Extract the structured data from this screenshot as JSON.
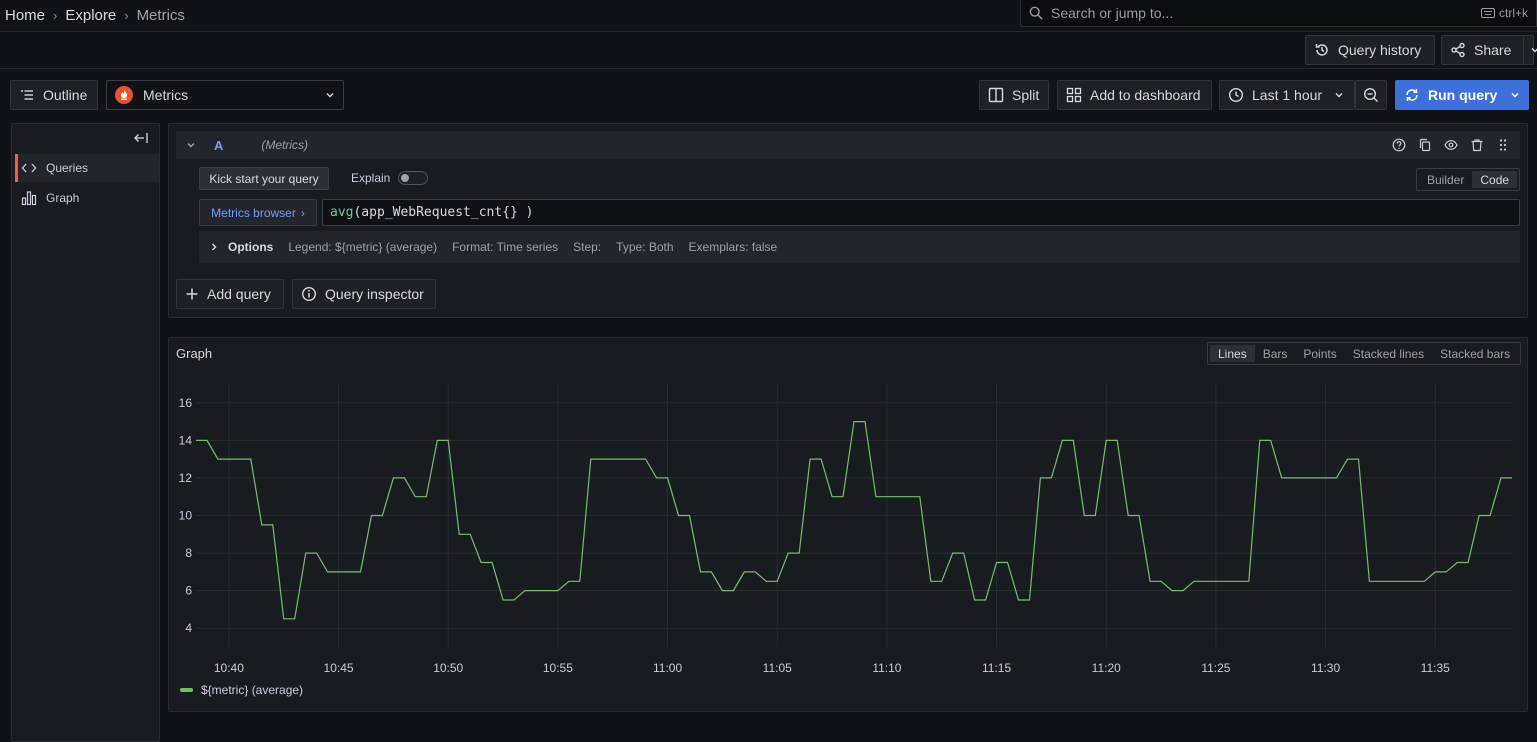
{
  "breadcrumb": {
    "home": "Home",
    "explore": "Explore",
    "current": "Metrics"
  },
  "search": {
    "placeholder": "Search or jump to...",
    "shortcut": "ctrl+k"
  },
  "topbar2": {
    "query_history": "Query history",
    "share": "Share"
  },
  "toolbar": {
    "outline": "Outline",
    "datasource": "Metrics",
    "split": "Split",
    "add_to_dashboard": "Add to dashboard",
    "time_range": "Last 1 hour",
    "run_query": "Run query"
  },
  "sidebar": {
    "items": [
      {
        "label": "Queries",
        "active": true
      },
      {
        "label": "Graph",
        "active": false
      }
    ]
  },
  "query": {
    "ref_id": "A",
    "datasource_name": "(Metrics)",
    "kick_start": "Kick start your query",
    "explain": "Explain",
    "mode_builder": "Builder",
    "mode_code": "Code",
    "metrics_browser": "Metrics browser",
    "expression_fn": "avg",
    "expression_rest": "(app_WebRequest_cnt{} )",
    "options_label": "Options",
    "opt_legend": "Legend: ${metric} (average)",
    "opt_format": "Format: Time series",
    "opt_step": "Step:",
    "opt_type": "Type: Both",
    "opt_exemplars": "Exemplars: false",
    "add_query": "Add query",
    "query_inspector": "Query inspector"
  },
  "graph": {
    "title": "Graph",
    "view_options": [
      "Lines",
      "Bars",
      "Points",
      "Stacked lines",
      "Stacked bars"
    ],
    "selected_view": "Lines"
  },
  "colors": {
    "accent": "#3d71d9",
    "series": "#73bf69",
    "active_marker": "#f55f3e"
  },
  "chart_data": {
    "type": "line",
    "title": "",
    "xlabel": "",
    "ylabel": "",
    "ylim": [
      3,
      17
    ],
    "y_ticks": [
      4,
      6,
      8,
      10,
      12,
      14,
      16
    ],
    "x_ticks": [
      "10:40",
      "10:45",
      "10:50",
      "10:55",
      "11:00",
      "11:05",
      "11:10",
      "11:15",
      "11:20",
      "11:25",
      "11:30",
      "11:35"
    ],
    "x_range": [
      "10:38:30",
      "11:38:30"
    ],
    "grid": true,
    "legend": "bottom-left",
    "series": [
      {
        "name": "${metric} (average)",
        "x": [
          "10:38:30",
          "10:39:00",
          "10:39:30",
          "10:40:00",
          "10:40:30",
          "10:41:00",
          "10:41:30",
          "10:42:00",
          "10:42:30",
          "10:43:00",
          "10:43:30",
          "10:44:00",
          "10:44:30",
          "10:45:00",
          "10:45:30",
          "10:46:00",
          "10:46:30",
          "10:47:00",
          "10:47:30",
          "10:48:00",
          "10:48:30",
          "10:49:00",
          "10:49:30",
          "10:50:00",
          "10:50:30",
          "10:51:00",
          "10:51:30",
          "10:52:00",
          "10:52:30",
          "10:53:00",
          "10:53:30",
          "10:54:00",
          "10:54:30",
          "10:55:00",
          "10:55:30",
          "10:56:00",
          "10:56:30",
          "10:57:00",
          "10:57:30",
          "10:58:00",
          "10:58:30",
          "10:59:00",
          "10:59:30",
          "11:00:00",
          "11:00:30",
          "11:01:00",
          "11:01:30",
          "11:02:00",
          "11:02:30",
          "11:03:00",
          "11:03:30",
          "11:04:00",
          "11:04:30",
          "11:05:00",
          "11:05:30",
          "11:06:00",
          "11:06:30",
          "11:07:00",
          "11:07:30",
          "11:08:00",
          "11:08:30",
          "11:09:00",
          "11:09:30",
          "11:10:00",
          "11:10:30",
          "11:11:00",
          "11:11:30",
          "11:12:00",
          "11:12:30",
          "11:13:00",
          "11:13:30",
          "11:14:00",
          "11:14:30",
          "11:15:00",
          "11:15:30",
          "11:16:00",
          "11:16:30",
          "11:17:00",
          "11:17:30",
          "11:18:00",
          "11:18:30",
          "11:19:00",
          "11:19:30",
          "11:20:00",
          "11:20:30",
          "11:21:00",
          "11:21:30",
          "11:22:00",
          "11:22:30",
          "11:23:00",
          "11:23:30",
          "11:24:00",
          "11:24:30",
          "11:25:00",
          "11:25:30",
          "11:26:00",
          "11:26:30",
          "11:27:00",
          "11:27:30",
          "11:28:00",
          "11:28:30",
          "11:29:00",
          "11:29:30",
          "11:30:00",
          "11:30:30",
          "11:31:00",
          "11:31:30",
          "11:32:00",
          "11:32:30",
          "11:33:00",
          "11:33:30",
          "11:34:00",
          "11:34:30",
          "11:35:00",
          "11:35:30",
          "11:36:00",
          "11:36:30",
          "11:37:00",
          "11:37:30",
          "11:38:00",
          "11:38:30"
        ],
        "values": [
          14,
          14,
          13,
          13,
          13,
          13,
          9.5,
          9.5,
          4.5,
          4.5,
          8,
          8,
          7,
          7,
          7,
          7,
          10,
          10,
          12,
          12,
          11,
          11,
          14,
          14,
          9,
          9,
          7.5,
          7.5,
          5.5,
          5.5,
          6,
          6,
          6,
          6,
          6.5,
          6.5,
          13,
          13,
          13,
          13,
          13,
          13,
          12,
          12,
          10,
          10,
          7,
          7,
          6,
          6,
          7,
          7,
          6.5,
          6.5,
          8,
          8,
          13,
          13,
          11,
          11,
          15,
          15,
          11,
          11,
          11,
          11,
          11,
          6.5,
          6.5,
          8,
          8,
          5.5,
          5.5,
          7.5,
          7.5,
          5.5,
          5.5,
          12,
          12,
          14,
          14,
          10,
          10,
          14,
          14,
          10,
          10,
          6.5,
          6.5,
          6,
          6,
          6.5,
          6.5,
          6.5,
          6.5,
          6.5,
          6.5,
          14,
          14,
          12,
          12,
          12,
          12,
          12,
          12,
          13,
          13,
          6.5,
          6.5,
          6.5,
          6.5,
          6.5,
          6.5,
          7,
          7,
          7.5,
          7.5,
          10,
          10,
          12,
          12
        ]
      }
    ]
  }
}
